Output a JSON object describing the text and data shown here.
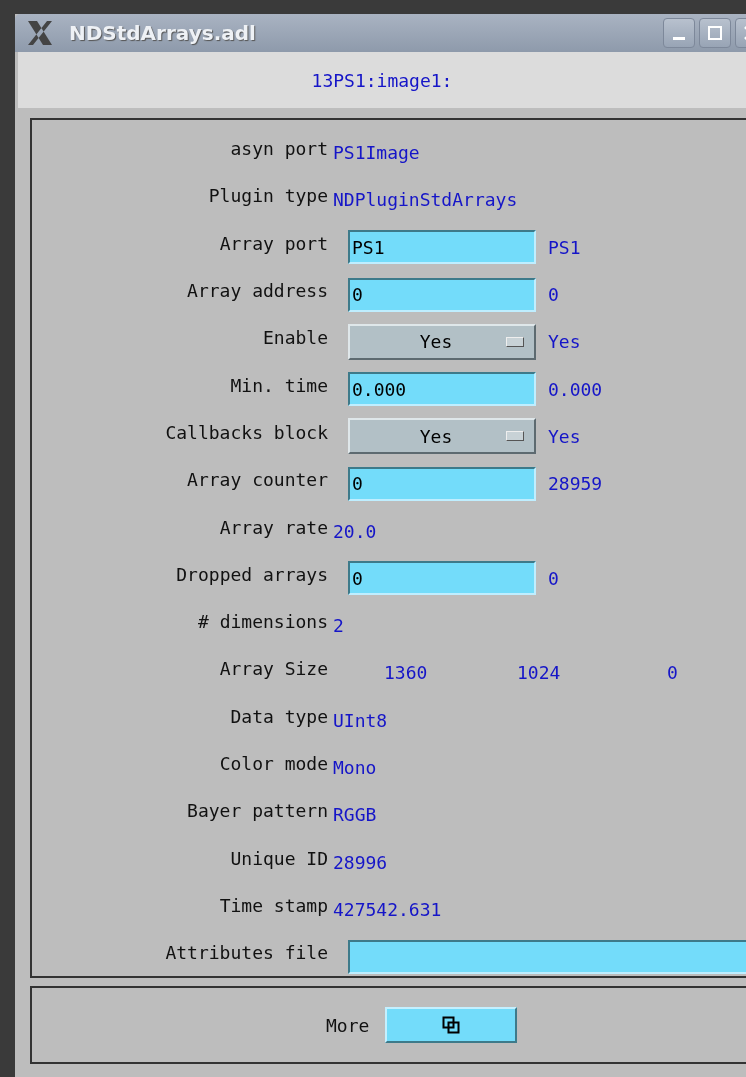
{
  "window": {
    "title": "NDStdArrays.adl"
  },
  "header": "13PS1:image1:",
  "rows": [
    {
      "label": "asyn port",
      "kind": "text",
      "value": "PS1Image"
    },
    {
      "label": "Plugin type",
      "kind": "text",
      "value": "NDPluginStdArrays"
    },
    {
      "label": "Array port",
      "kind": "input",
      "value": "PS1",
      "readback": "PS1"
    },
    {
      "label": "Array address",
      "kind": "input",
      "value": "0",
      "readback": "0"
    },
    {
      "label": "Enable",
      "kind": "menu",
      "value": "Yes",
      "readback": "Yes"
    },
    {
      "label": "Min. time",
      "kind": "input",
      "value": "0.000",
      "readback": "0.000"
    },
    {
      "label": "Callbacks block",
      "kind": "menu",
      "value": "Yes",
      "readback": "Yes"
    },
    {
      "label": "Array counter",
      "kind": "input",
      "value": "0",
      "readback": "28959"
    },
    {
      "label": "Array rate",
      "kind": "text",
      "value": "20.0"
    },
    {
      "label": "Dropped arrays",
      "kind": "input",
      "value": "0",
      "readback": "0"
    },
    {
      "label": "# dimensions",
      "kind": "text",
      "value": "2"
    },
    {
      "label": "Array Size",
      "kind": "size",
      "values": [
        "1360",
        "1024",
        "0"
      ]
    },
    {
      "label": "Data type",
      "kind": "text",
      "value": "UInt8"
    },
    {
      "label": "Color mode",
      "kind": "text",
      "value": "Mono"
    },
    {
      "label": "Bayer pattern",
      "kind": "text",
      "value": "RGGB"
    },
    {
      "label": "Unique ID",
      "kind": "text",
      "value": "28996"
    },
    {
      "label": "Time stamp",
      "kind": "text",
      "value": "427542.631"
    },
    {
      "label": "Attributes file",
      "kind": "wide-input"
    }
  ],
  "more": {
    "label": "More"
  }
}
